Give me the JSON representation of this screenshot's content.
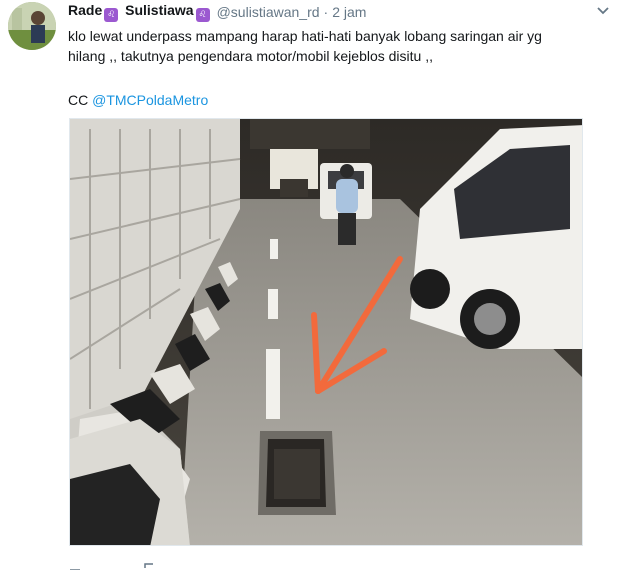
{
  "tweet": {
    "author": {
      "name_first": "Rade",
      "name_second": "Sulistiawa",
      "emoji": "♌",
      "handle": "@sulistiawan_rd",
      "separator": "·",
      "time": "2 jam"
    },
    "text_lines": [
      "klo lewat underpass mampang harap hati-hati banyak lobang saringan air yg",
      "hilang ,, takutnya pengendara motor/mobil kejeblos disitu ,,"
    ],
    "cc_prefix": "CC ",
    "mention": "@TMCPoldaMetro",
    "colors": {
      "text": "#14171a",
      "secondary": "#657786",
      "link": "#1b95e0",
      "emoji_bg": "#9b59d0"
    },
    "icons": [
      "avatar",
      "chevron-down-icon",
      "reply-icon",
      "retweet-icon"
    ]
  }
}
